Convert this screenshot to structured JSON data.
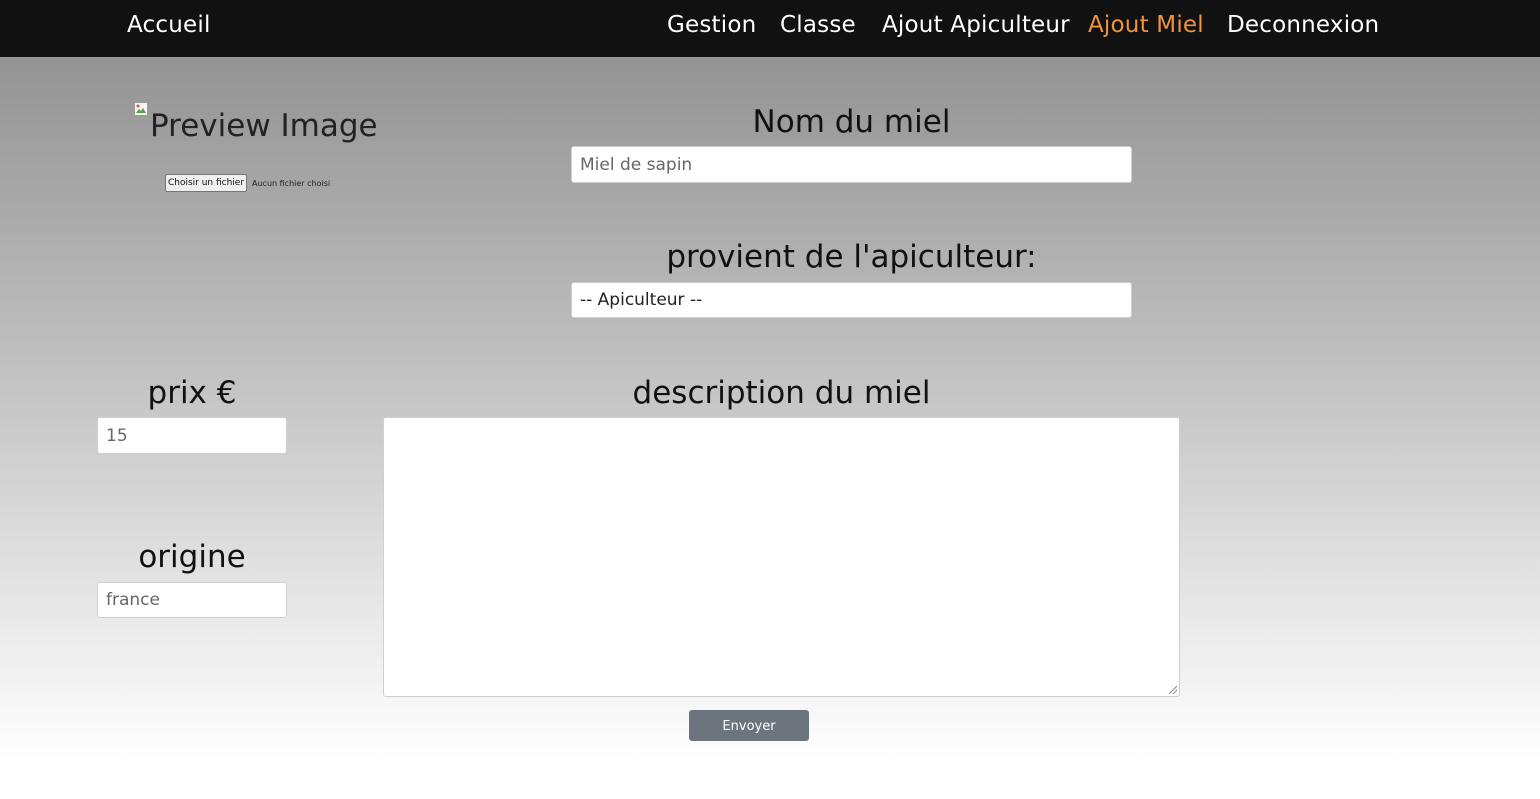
{
  "nav": {
    "brand": "Accueil",
    "links": [
      "Gestion",
      "Classe",
      "Ajout Apiculteur",
      "Ajout Miel",
      "Deconnexion"
    ],
    "active_link": "Ajout Miel",
    "active_color": "#f0933a"
  },
  "image_upload": {
    "preview_alt": "Preview Image",
    "file_button_label": "Choisir un fichier",
    "file_status": "Aucun fichier choisi"
  },
  "form": {
    "name_label": "Nom du miel",
    "name_placeholder": "Miel de sapin",
    "beekeeper_label": "provient de l'apiculteur:",
    "beekeeper_selected": "-- Apiculteur --",
    "price_label": "prix €",
    "price_placeholder": "15",
    "origin_label": "origine",
    "origin_placeholder": "france",
    "description_label": "description du miel",
    "description_value": "",
    "submit_label": "Envoyer"
  }
}
